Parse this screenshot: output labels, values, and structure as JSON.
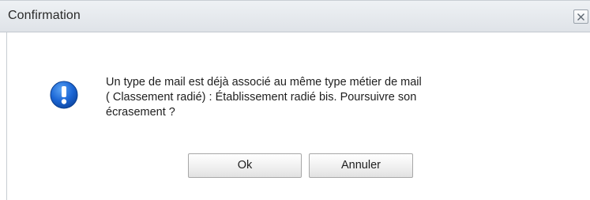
{
  "dialog": {
    "title": "Confirmation",
    "close_icon": "close-icon",
    "message_icon": "exclamation-info-icon",
    "message_lines": [
      "Un type de mail est déjà associé au même type métier de mail",
      "( Classement radié) : Établissement radié bis. Poursuivre son",
      "écrasement ?"
    ],
    "buttons": {
      "ok_label": "Ok",
      "cancel_label": "Annuler"
    }
  },
  "colors": {
    "icon_blue": "#1c67d6",
    "titlebar": "#e4e8ec"
  }
}
